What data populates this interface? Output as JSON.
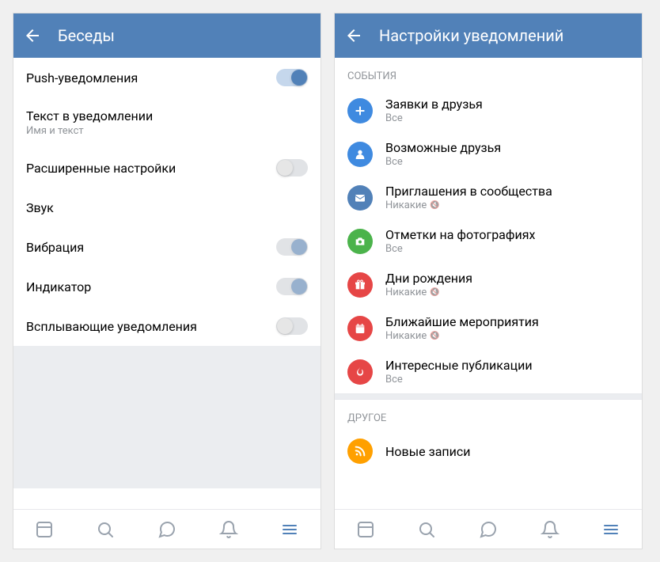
{
  "left": {
    "header": {
      "title": "Беседы"
    },
    "rows": [
      {
        "title": "Push-уведомления",
        "toggle": "on"
      },
      {
        "title": "Текст в уведомлении",
        "sub": "Имя и текст"
      },
      {
        "title": "Расширенные настройки",
        "toggle": "off"
      },
      {
        "title": "Звук"
      },
      {
        "title": "Вибрация",
        "toggle": "half"
      },
      {
        "title": "Индикатор",
        "toggle": "half"
      },
      {
        "title": "Всплывающие уведомления",
        "toggle": "off"
      }
    ]
  },
  "right": {
    "header": {
      "title": "Настройки уведомлений"
    },
    "section1": {
      "title": "СОБЫТИЯ"
    },
    "section2": {
      "title": "ДРУГОЕ"
    },
    "items": [
      {
        "title": "Заявки в друзья",
        "sub": "Все",
        "muted": false,
        "color": "#3F8AE0",
        "icon": "plus"
      },
      {
        "title": "Возможные друзья",
        "sub": "Все",
        "muted": false,
        "color": "#3F8AE0",
        "icon": "user"
      },
      {
        "title": "Приглашения в сообщества",
        "sub": "Никакие",
        "muted": true,
        "color": "#5181B8",
        "icon": "mail"
      },
      {
        "title": "Отметки на фотографиях",
        "sub": "Все",
        "muted": false,
        "color": "#4BB34B",
        "icon": "camera"
      },
      {
        "title": "Дни рождения",
        "sub": "Никакие",
        "muted": true,
        "color": "#E64646",
        "icon": "gift"
      },
      {
        "title": "Ближайшие мероприятия",
        "sub": "Никакие",
        "muted": true,
        "color": "#E64646",
        "icon": "calendar"
      },
      {
        "title": "Интересные публикации",
        "sub": "Все",
        "muted": false,
        "color": "#E64646",
        "icon": "fire"
      }
    ],
    "items2": [
      {
        "title": "Новые записи",
        "sub": "",
        "color": "#FFA000",
        "icon": "rss"
      }
    ]
  },
  "nav": {
    "items": [
      "news",
      "search",
      "messages",
      "notifications",
      "menu"
    ]
  }
}
